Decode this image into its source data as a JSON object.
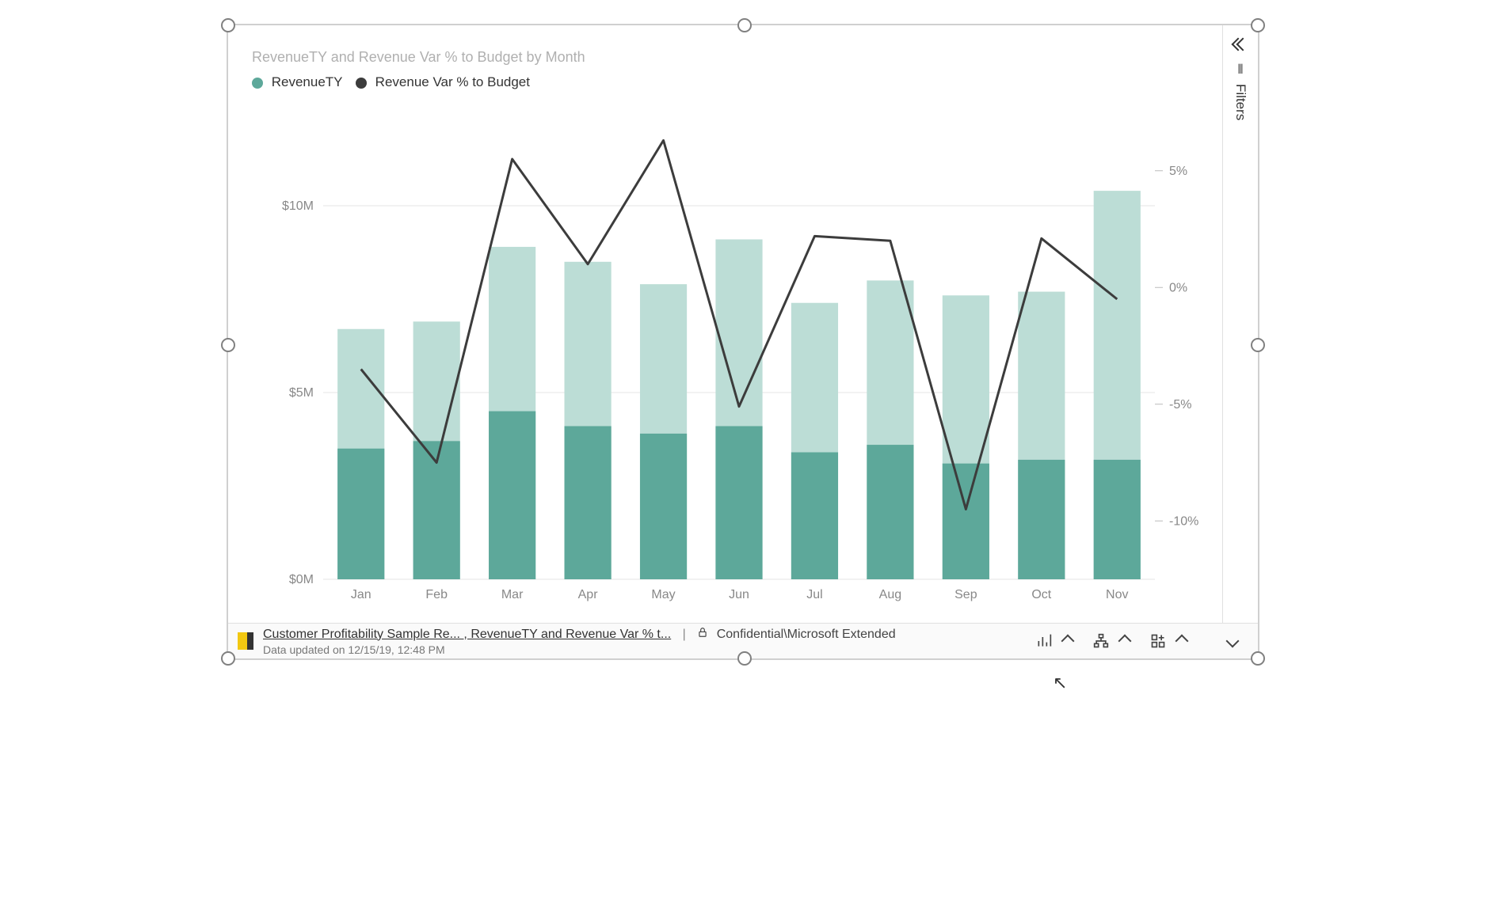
{
  "chart_data": {
    "type": "bar+line",
    "title": "RevenueTY and Revenue Var % to Budget by Month",
    "categories": [
      "Jan",
      "Feb",
      "Mar",
      "Apr",
      "May",
      "Jun",
      "Jul",
      "Aug",
      "Sep",
      "Oct",
      "Nov"
    ],
    "x": [
      "Jan",
      "Feb",
      "Mar",
      "Apr",
      "May",
      "Jun",
      "Jul",
      "Aug",
      "Sep",
      "Oct",
      "Nov"
    ],
    "series": [
      {
        "name": "RevenueTY_upper",
        "role": "stack-top",
        "color": "#BCDDD6",
        "values": [
          6.7,
          6.9,
          8.9,
          8.5,
          7.9,
          9.1,
          7.4,
          8.0,
          7.6,
          7.7,
          10.4
        ]
      },
      {
        "name": "RevenueTY_lower",
        "role": "stack-bottom",
        "color": "#5DA89A",
        "values": [
          3.5,
          3.7,
          4.5,
          4.1,
          3.9,
          4.1,
          3.4,
          3.6,
          3.1,
          3.2,
          3.2
        ]
      },
      {
        "name": "Revenue Var % to Budget",
        "role": "line",
        "color": "#3C3C3C",
        "values": [
          -3.5,
          -7.5,
          5.5,
          1.0,
          6.3,
          -5.1,
          2.2,
          2.0,
          -9.5,
          2.1,
          -0.5
        ]
      }
    ],
    "y_left": {
      "label": "",
      "ticks": [
        "$0M",
        "$5M",
        "$10M"
      ],
      "range": [
        0,
        12.5
      ]
    },
    "y_right": {
      "label": "",
      "ticks": [
        "-10%",
        "-5%",
        "0%",
        "5%"
      ],
      "range": [
        -12.5,
        7.5
      ]
    },
    "legend": [
      {
        "label": "RevenueTY",
        "color": "#5DA89A"
      },
      {
        "label": "Revenue Var % to Budget",
        "color": "#3C3C3C"
      }
    ]
  },
  "footer": {
    "breadcrumb": "Customer Profitability Sample Re... , RevenueTY and Revenue Var % t...",
    "sensitivity": "Confidential\\Microsoft Extended",
    "updated": "Data updated on 12/15/19, 12:48 PM"
  },
  "filters": {
    "label": "Filters"
  }
}
